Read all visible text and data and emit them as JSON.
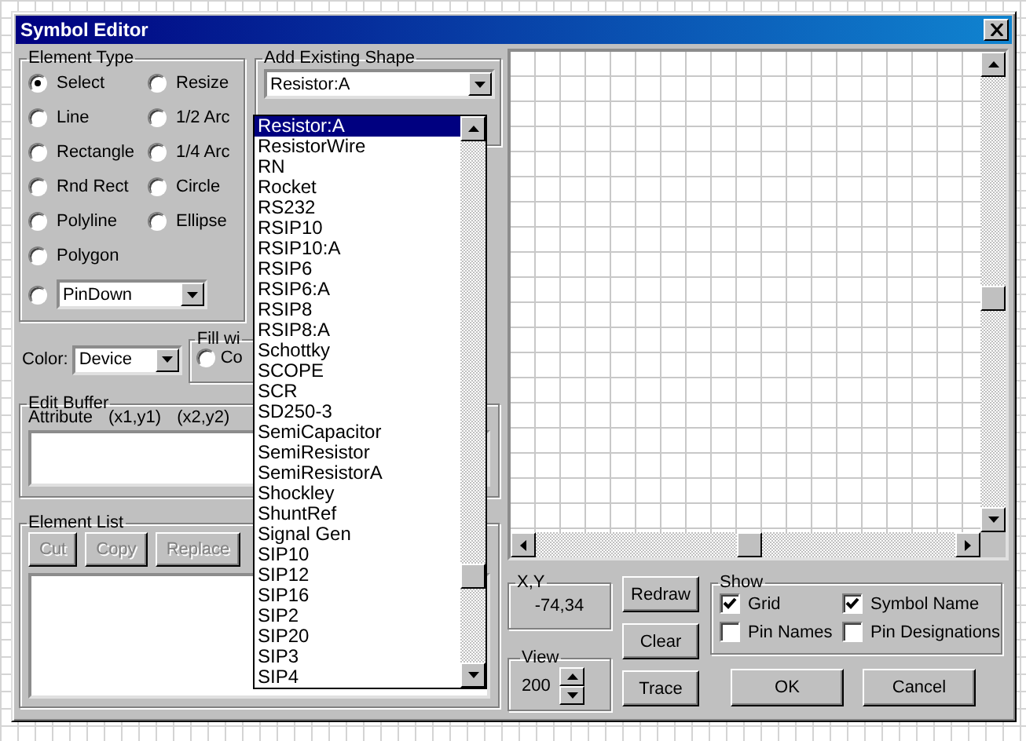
{
  "window": {
    "title": "Symbol Editor"
  },
  "element_type": {
    "label": "Element Type",
    "options": [
      {
        "label": "Select",
        "selected": true
      },
      {
        "label": "Resize",
        "selected": false
      },
      {
        "label": "Line",
        "selected": false
      },
      {
        "label": "1/2 Arc",
        "selected": false
      },
      {
        "label": "Rectangle",
        "selected": false
      },
      {
        "label": "1/4 Arc",
        "selected": false
      },
      {
        "label": "Rnd Rect",
        "selected": false
      },
      {
        "label": "Circle",
        "selected": false
      },
      {
        "label": "Polyline",
        "selected": false
      },
      {
        "label": "Ellipse",
        "selected": false
      },
      {
        "label": "Polygon",
        "selected": false
      }
    ],
    "pin": {
      "selected": false,
      "value": "PinDown"
    }
  },
  "add_shape": {
    "label": "Add Existing Shape",
    "value": "Resistor:A",
    "items": [
      {
        "label": "Resistor:A",
        "selected": true
      },
      {
        "label": "ResistorWire",
        "selected": false
      },
      {
        "label": "RN",
        "selected": false
      },
      {
        "label": "Rocket",
        "selected": false
      },
      {
        "label": "RS232",
        "selected": false
      },
      {
        "label": "RSIP10",
        "selected": false
      },
      {
        "label": "RSIP10:A",
        "selected": false
      },
      {
        "label": "RSIP6",
        "selected": false
      },
      {
        "label": "RSIP6:A",
        "selected": false
      },
      {
        "label": "RSIP8",
        "selected": false
      },
      {
        "label": "RSIP8:A",
        "selected": false
      },
      {
        "label": "Schottky",
        "selected": false
      },
      {
        "label": "SCOPE",
        "selected": false
      },
      {
        "label": "SCR",
        "selected": false
      },
      {
        "label": "SD250-3",
        "selected": false
      },
      {
        "label": "SemiCapacitor",
        "selected": false
      },
      {
        "label": "SemiResistor",
        "selected": false
      },
      {
        "label": "SemiResistorA",
        "selected": false
      },
      {
        "label": "Shockley",
        "selected": false
      },
      {
        "label": "ShuntRef",
        "selected": false
      },
      {
        "label": "Signal Gen",
        "selected": false
      },
      {
        "label": "SIP10",
        "selected": false
      },
      {
        "label": "SIP12",
        "selected": false
      },
      {
        "label": "SIP16",
        "selected": false
      },
      {
        "label": "SIP2",
        "selected": false
      },
      {
        "label": "SIP20",
        "selected": false
      },
      {
        "label": "SIP3",
        "selected": false
      },
      {
        "label": "SIP4",
        "selected": false
      }
    ]
  },
  "color": {
    "label": "Color:",
    "value": "Device"
  },
  "fill": {
    "label": "Fill wi",
    "option": {
      "label": "Co",
      "selected": false
    }
  },
  "edit_buffer": {
    "label": "Edit Buffer",
    "columns": [
      "Attribute",
      "(x1,y1)",
      "(x2,y2)"
    ]
  },
  "element_list": {
    "label": "Element List",
    "buttons": [
      {
        "label": "Cut",
        "disabled": true
      },
      {
        "label": "Copy",
        "disabled": true
      },
      {
        "label": "Replace",
        "disabled": true
      }
    ]
  },
  "xy": {
    "label": "X,Y",
    "value": "-74,34"
  },
  "view": {
    "label": "View",
    "value": "200"
  },
  "actions": [
    "Redraw",
    "Clear",
    "Trace"
  ],
  "show": {
    "label": "Show",
    "options": [
      {
        "label": "Grid",
        "checked": true
      },
      {
        "label": "Symbol Name",
        "checked": true
      },
      {
        "label": "Pin Names",
        "checked": false
      },
      {
        "label": "Pin Designations",
        "checked": false
      }
    ]
  },
  "dialog_buttons": [
    "OK",
    "Cancel"
  ]
}
